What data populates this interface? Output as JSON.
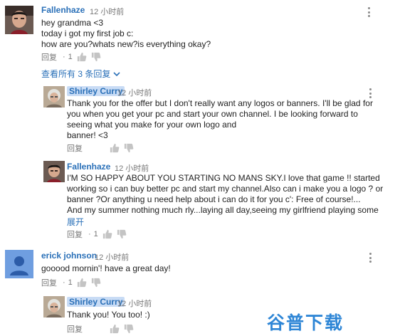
{
  "colors": {
    "link": "#2a70b8",
    "meta": "#777777",
    "highlight": "#c9dcf5",
    "watermark": "#2e86d6"
  },
  "comments": [
    {
      "author": "Fallenhaze",
      "time": "12 小时前",
      "text": "hey grandma <3\ntoday i got my first job c:\nhow are you?whats new?is everything okay?",
      "reply_label": "回复",
      "likes": "1",
      "avatar_icon": "user-photo-avatar"
    }
  ],
  "view_replies": "查看所有 3 条回复",
  "replies": [
    {
      "author": "Shirley Curry",
      "time": "12 小时前",
      "text": "Thank you for the offer but I don't really want any logos or banners. I'll be glad for\nyou when you get your pc and start your own channel.  I be looking forward to\nseeing what you make for your own logo and\nbanner! <3",
      "reply_label": "回复",
      "likes": ""
    },
    {
      "author": "Fallenhaze",
      "time": "12 小时前",
      "text": "I'M SO HAPPY ABOUT YOU STARTING NO MANS SKY.I love that game !! started\nworking so i can buy better pc and start my channel.Also can i make you a logo ? or\nbanner ?Or anything u need help about i can do it for you c': Free of course!...\nAnd my summer nothing much rly...laying all day,seeing my girlfriend playing some",
      "show_more": "展开",
      "reply_label": "回复",
      "likes": "1"
    }
  ],
  "comment2": {
    "author": "erick johnson",
    "time": "12 小时前",
    "text": "gooood mornin'! have a great day!",
    "reply_label": "回复",
    "likes": "1"
  },
  "reply3": {
    "author": "Shirley Curry",
    "time": "12 小时前",
    "text": "Thank you! You too! :)",
    "reply_label": "回复",
    "likes": ""
  },
  "watermark": "谷普下载"
}
